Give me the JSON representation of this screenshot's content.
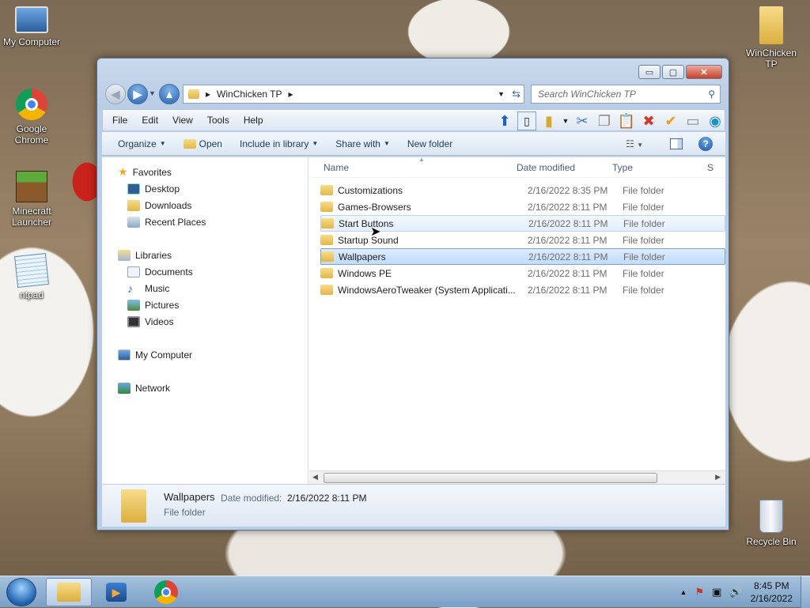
{
  "desktop": {
    "icons": [
      {
        "label": "My Computer"
      },
      {
        "label": "Google Chrome"
      },
      {
        "label": "Minecraft Launcher"
      },
      {
        "label": "ntpad"
      },
      {
        "label": "WinChicken TP"
      },
      {
        "label": "Recycle Bin"
      }
    ]
  },
  "window": {
    "caption_buttons": {
      "minimize": "▭",
      "maximize": "▢",
      "close": "✕"
    },
    "address": {
      "arrow": "▸",
      "path": "WinChicken TP",
      "trailing_arrow": "▸"
    },
    "search": {
      "placeholder": "Search WinChicken TP"
    },
    "menu": [
      "File",
      "Edit",
      "View",
      "Tools",
      "Help"
    ],
    "commands": {
      "organize": "Organize",
      "open": "Open",
      "include_in_library": "Include in library",
      "share_with": "Share with",
      "new_folder": "New folder"
    },
    "nav": {
      "favorites": "Favorites",
      "desktop": "Desktop",
      "downloads": "Downloads",
      "recent_places": "Recent Places",
      "libraries": "Libraries",
      "documents": "Documents",
      "music": "Music",
      "pictures": "Pictures",
      "videos": "Videos",
      "my_computer": "My Computer",
      "network": "Network"
    },
    "columns": {
      "name": "Name",
      "date_modified": "Date modified",
      "type": "Type",
      "size": "S"
    },
    "files": [
      {
        "name": "Customizations",
        "date": "2/16/2022 8:35 PM",
        "type": "File folder"
      },
      {
        "name": "Games-Browsers",
        "date": "2/16/2022 8:11 PM",
        "type": "File folder"
      },
      {
        "name": "Start Buttons",
        "date": "2/16/2022 8:11 PM",
        "type": "File folder"
      },
      {
        "name": "Startup Sound",
        "date": "2/16/2022 8:11 PM",
        "type": "File folder"
      },
      {
        "name": "Wallpapers",
        "date": "2/16/2022 8:11 PM",
        "type": "File folder"
      },
      {
        "name": "Windows PE",
        "date": "2/16/2022 8:11 PM",
        "type": "File folder"
      },
      {
        "name": "WindowsAeroTweaker (System Applicati...",
        "date": "2/16/2022 8:11 PM",
        "type": "File folder"
      }
    ],
    "details": {
      "name": "Wallpapers",
      "date_label": "Date modified:",
      "date_value": "2/16/2022 8:11 PM",
      "type": "File folder"
    }
  },
  "taskbar": {
    "time": "8:45 PM",
    "date": "2/16/2022"
  },
  "colors": {
    "selection": "#c1dcfc",
    "taskbar": "#7a9fc6"
  }
}
